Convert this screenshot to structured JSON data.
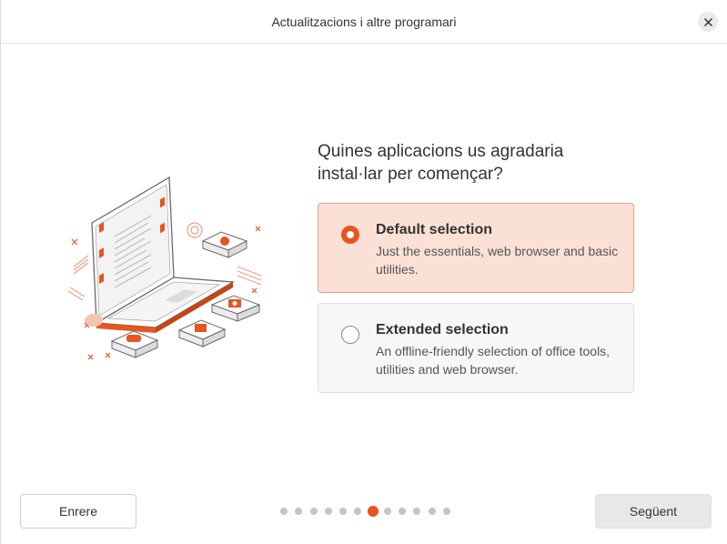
{
  "window": {
    "title": "Actualitzacions i altre programari"
  },
  "question": "Quines aplicacions us agradaria instal·lar per començar?",
  "options": [
    {
      "title": "Default selection",
      "description": "Just the essentials, web browser and basic utilities.",
      "selected": true
    },
    {
      "title": "Extended selection",
      "description": "An offline-friendly selection of office tools, utilities and web browser.",
      "selected": false
    }
  ],
  "buttons": {
    "back": "Enrere",
    "next": "Següent"
  },
  "progress": {
    "total_steps": 12,
    "current_step": 7
  },
  "colors": {
    "accent": "#e95420",
    "selected_bg": "#fbe0d6"
  }
}
